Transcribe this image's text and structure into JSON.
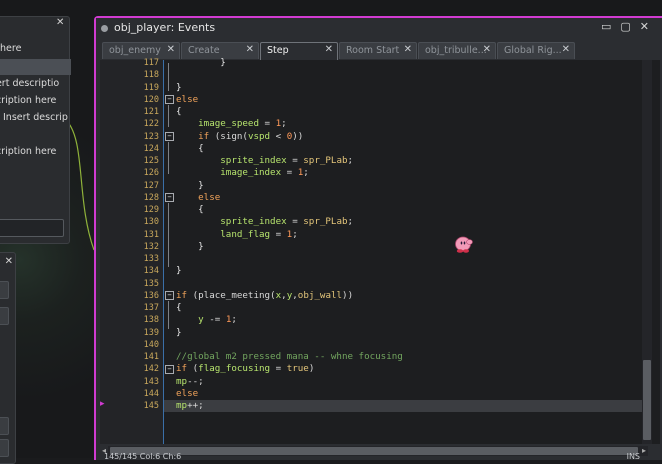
{
  "window": {
    "title": "obj_player: Events",
    "accent": "#d13bd2"
  },
  "tabs": [
    {
      "label": "obj_enemy",
      "active": false
    },
    {
      "label": "Create",
      "active": false
    },
    {
      "label": "Step",
      "active": true
    },
    {
      "label": "Room Start",
      "active": false
    },
    {
      "label": "obj_tribulle...",
      "active": false
    },
    {
      "label": "Global Rig...",
      "active": false
    }
  ],
  "left_panel": {
    "items": [
      {
        "text": "n here"
      },
      {
        "text": ""
      },
      {
        "text": "sert descriptio"
      },
      {
        "text": "scription here"
      },
      {
        "text": "Insert descrip"
      },
      {
        "text": "scription here"
      }
    ]
  },
  "editor": {
    "line_numbers": [
      "117",
      "118",
      "119",
      "120",
      "121",
      "122",
      "123",
      "124",
      "125",
      "126",
      "127",
      "128",
      "129",
      "130",
      "131",
      "132",
      "133",
      "134",
      "135",
      "136",
      "137",
      "138",
      "139",
      "140",
      "141",
      "142",
      "143",
      "144",
      "145"
    ],
    "current_line": "145",
    "code": {
      "l117": "}",
      "l118": "",
      "l119": "}",
      "l120_kw": "else",
      "l121": "{",
      "l122_var": "image_speed",
      "l122_rest": " = ",
      "l122_num": "1",
      "l123_kw": "if",
      "l123_a": " (sign(",
      "l123_var": "vspd",
      "l123_b": " < ",
      "l123_num": "0",
      "l123_c": "))",
      "l124": "{",
      "l125_var": "sprite_index",
      "l125_rest": " = ",
      "l125_res": "spr_PLab",
      "l125_end": ";",
      "l126_var": "image_index",
      "l126_rest": " = ",
      "l126_num": "1",
      "l126_end": ";",
      "l127": "}",
      "l128_kw": "else",
      "l129": "{",
      "l130_var": "sprite_index",
      "l130_rest": " = ",
      "l130_res": "spr_PLab",
      "l130_end": ";",
      "l131_var": "land_flag",
      "l131_rest": " = ",
      "l131_num": "1",
      "l131_end": ";",
      "l132": "}",
      "l133": "",
      "l134": "}",
      "l135": "",
      "l136_kw": "if",
      "l136_a": " (place_meeting(",
      "l136_var1": "x",
      "l136_b": ",",
      "l136_var2": "y",
      "l136_c": ",",
      "l136_res": "obj_wall",
      "l136_d": "))",
      "l137": "{",
      "l138_var": "y",
      "l138_rest": " -= ",
      "l138_num": "1",
      "l138_end": ";",
      "l139": "}",
      "l140": "",
      "l141_cmt": "//global m2 pressed mana -- whne focusing",
      "l142_kw": "if",
      "l142_a": " (",
      "l142_var": "flag_focusing",
      "l142_b": " = ",
      "l142_res": "true",
      "l142_c": ")",
      "l143_var": "mp",
      "l143_rest": "--;",
      "l144_kw": "else",
      "l145_var": "mp",
      "l145_rest": "++;"
    }
  },
  "status": {
    "left": "145/145 Col:6 Ch:6",
    "right": "INS"
  }
}
